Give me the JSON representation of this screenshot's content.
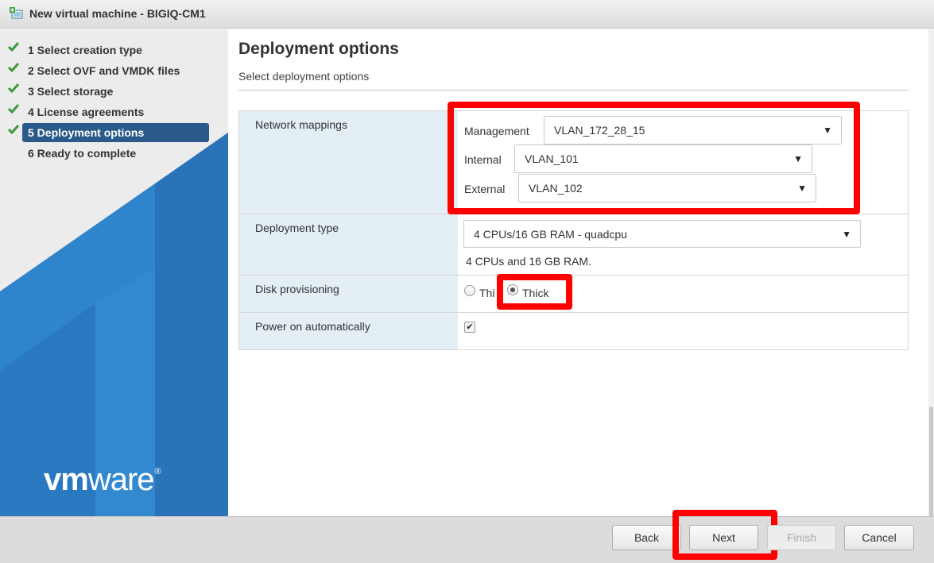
{
  "window": {
    "title": "New virtual machine - BIGIQ-CM1"
  },
  "sidebar": {
    "steps": [
      {
        "label": "1  Select creation type",
        "done": true
      },
      {
        "label": "2  Select OVF and VMDK files",
        "done": true
      },
      {
        "label": "3  Select storage",
        "done": true
      },
      {
        "label": "4  License agreements",
        "done": true
      },
      {
        "label": "5  Deployment options",
        "done": true,
        "active": true
      },
      {
        "label": "6  Ready to complete",
        "done": false
      }
    ],
    "brand": {
      "bold": "vm",
      "rest": "ware",
      "mark": "®"
    }
  },
  "main": {
    "title": "Deployment options",
    "subtitle": "Select deployment options",
    "network": {
      "label": "Network mappings",
      "management": {
        "label": "Management",
        "value": "VLAN_172_28_15"
      },
      "internal": {
        "label": "Internal",
        "value": "VLAN_101"
      },
      "external": {
        "label": "External",
        "value": "VLAN_102"
      }
    },
    "deployment_type": {
      "label": "Deployment type",
      "value": "4 CPUs/16 GB RAM - quadcpu",
      "description": "4 CPUs and 16 GB RAM."
    },
    "disk": {
      "label": "Disk provisioning",
      "thin_label": "Thi",
      "thick_label": "Thick",
      "selected": "Thick"
    },
    "power": {
      "label": "Power on automatically",
      "checked": true
    }
  },
  "footer": {
    "back": "Back",
    "next": "Next",
    "finish": "Finish",
    "cancel": "Cancel"
  },
  "colors": {
    "highlight": "#ff0000",
    "active_step": "#2a5a8a",
    "brand_blue": "#1d6fb8"
  }
}
